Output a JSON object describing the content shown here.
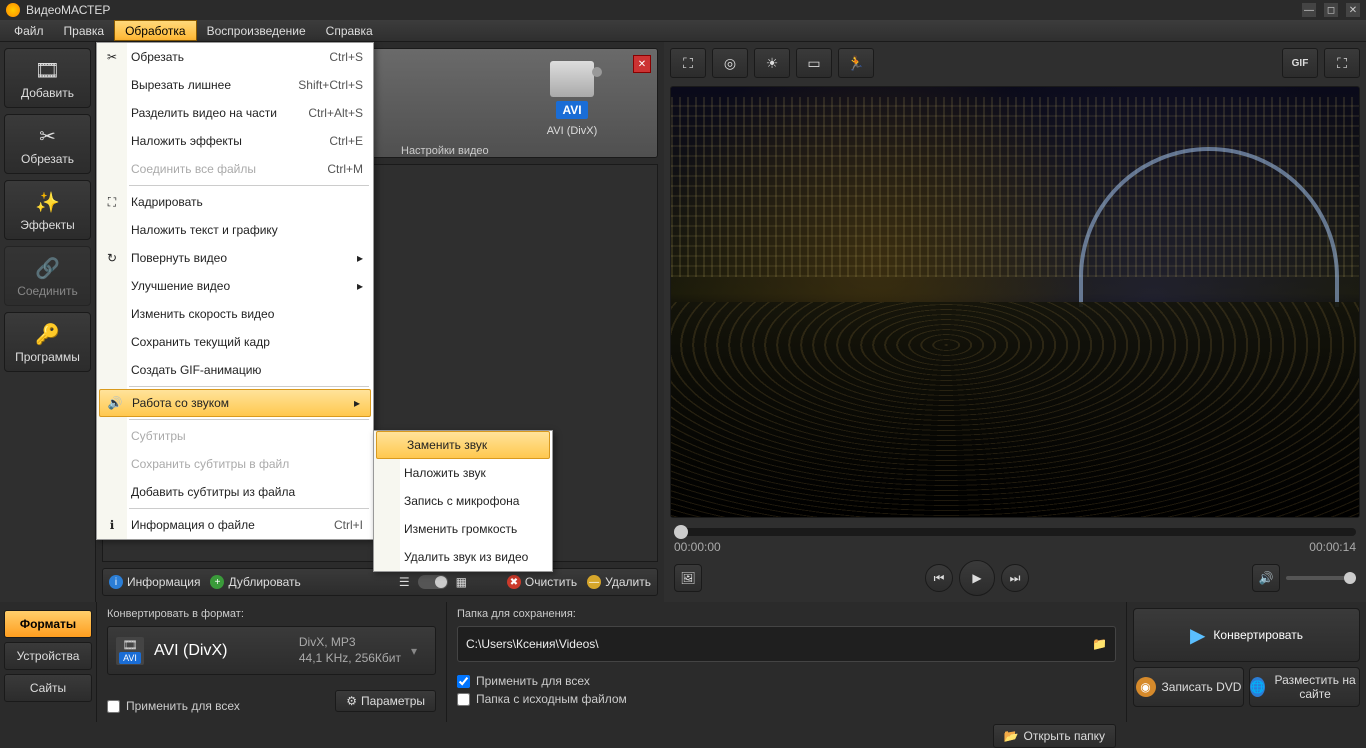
{
  "app_title": "ВидеоМАСТЕР",
  "menubar": [
    "Файл",
    "Правка",
    "Обработка",
    "Воспроизведение",
    "Справка"
  ],
  "active_menu_index": 2,
  "leftbar": [
    {
      "label": "Добавить",
      "icon": "🎞"
    },
    {
      "label": "Обрезать",
      "icon": "✂"
    },
    {
      "label": "Эффекты",
      "icon": "✨"
    },
    {
      "label": "Соединить",
      "icon": "🔗",
      "disabled": true
    },
    {
      "label": "Программы",
      "icon": "🔑"
    }
  ],
  "dropdown": [
    {
      "label": "Обрезать",
      "shortcut": "Ctrl+S",
      "icon": "✂"
    },
    {
      "label": "Вырезать лишнее",
      "shortcut": "Shift+Ctrl+S"
    },
    {
      "label": "Разделить видео на части",
      "shortcut": "Ctrl+Alt+S"
    },
    {
      "label": "Наложить эффекты",
      "shortcut": "Ctrl+E"
    },
    {
      "label": "Соединить все файлы",
      "shortcut": "Ctrl+M",
      "disabled": true
    },
    {
      "sep": true
    },
    {
      "label": "Кадрировать",
      "icon": "⛶"
    },
    {
      "label": "Наложить текст и графику"
    },
    {
      "label": "Повернуть видео",
      "submenu": true,
      "icon": "↻"
    },
    {
      "label": "Улучшение видео",
      "submenu": true
    },
    {
      "label": "Изменить скорость видео"
    },
    {
      "label": "Сохранить текущий кадр"
    },
    {
      "label": "Создать GIF-анимацию"
    },
    {
      "sep": true
    },
    {
      "label": "Работа со звуком",
      "submenu": true,
      "hl": true,
      "icon": "🔊"
    },
    {
      "sep": true
    },
    {
      "label": "Субтитры",
      "disabled": true
    },
    {
      "label": "Сохранить субтитры в файл",
      "disabled": true
    },
    {
      "label": "Добавить субтитры из файла"
    },
    {
      "sep": true
    },
    {
      "label": "Информация о файле",
      "shortcut": "Ctrl+I",
      "icon": "ℹ"
    }
  ],
  "submenu": [
    {
      "label": "Заменить звук",
      "hl": true
    },
    {
      "label": "Наложить звук"
    },
    {
      "label": "Запись с микрофона"
    },
    {
      "label": "Изменить громкость"
    },
    {
      "label": "Удалить звук из видео"
    }
  ],
  "format_card": {
    "badge": "AVI",
    "sub": "AVI (DivX)"
  },
  "settings_label": "Настройки видео",
  "listfoot": {
    "info": "Информация",
    "dup": "Дублировать",
    "clear": "Очистить",
    "del": "Удалить"
  },
  "right_toolbar_icons": [
    "crop",
    "aspect",
    "brightness",
    "frame",
    "speed"
  ],
  "gif_label": "GIF",
  "time_current": "00:00:00",
  "time_total": "00:00:14",
  "bottom_tabs": [
    "Форматы",
    "Устройства",
    "Сайты"
  ],
  "bottom_tab_active": 0,
  "convert_label": "Конвертировать в формат:",
  "format": {
    "name": "AVI (DivX)",
    "line1": "DivX, MP3",
    "line2": "44,1 KHz, 256Кбит",
    "badge": "AVI"
  },
  "apply_all": "Применить для всех",
  "params_btn": "Параметры",
  "folder_label": "Папка для сохранения:",
  "folder_path": "C:\\Users\\Ксения\\Videos\\",
  "folder_apply": "Применить для всех",
  "folder_src": "Папка с исходным файлом",
  "open_folder": "Открыть папку",
  "convert_btn": "Конвертировать",
  "burn_btn": "Записать DVD",
  "publish_btn": "Разместить на сайте"
}
